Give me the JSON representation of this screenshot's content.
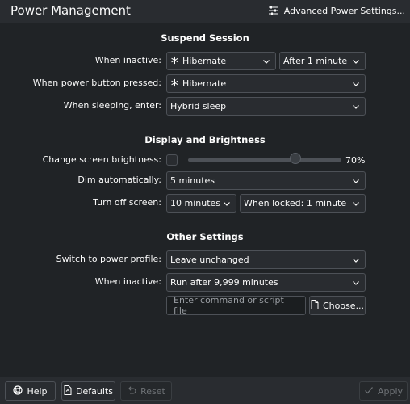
{
  "header": {
    "title": "Power Management",
    "advanced_label": "Advanced Power Settings..."
  },
  "suspend": {
    "title": "Suspend Session",
    "inactive_label": "When inactive:",
    "inactive_action": "Hibernate",
    "inactive_delay": "After 1 minute",
    "power_button_label": "When power button pressed:",
    "power_button_action": "Hibernate",
    "sleeping_label": "When sleeping, enter:",
    "sleeping_mode": "Hybrid sleep"
  },
  "display": {
    "title": "Display and Brightness",
    "brightness_label": "Change screen brightness:",
    "brightness_checked": false,
    "brightness_value": "70%",
    "brightness_fraction": 0.7,
    "dim_label": "Dim automatically:",
    "dim_value": "5 minutes",
    "turn_off_label": "Turn off screen:",
    "turn_off_value": "10 minutes",
    "turn_off_locked": "When locked: 1 minute"
  },
  "other": {
    "title": "Other Settings",
    "profile_label": "Switch to power profile:",
    "profile_value": "Leave unchanged",
    "inactive_label": "When inactive:",
    "inactive_value": "Run after 9,999 minutes",
    "command_placeholder": "Enter command or script file",
    "choose_label": "Choose..."
  },
  "footer": {
    "help_label": "Help",
    "defaults_label": "Defaults",
    "reset_label": "Reset",
    "apply_label": "Apply"
  },
  "icons": {
    "hibernate": "snowflake-icon",
    "advanced": "sliders-icon",
    "help": "lifebuoy-icon",
    "defaults": "document-revert-icon",
    "reset": "undo-icon",
    "apply": "checkmark-icon",
    "choose": "file-icon"
  },
  "colors": {
    "background": "#202326",
    "header": "#292c30",
    "border": "#4d5157",
    "text": "#fcfcfc",
    "disabled_text": "#6e7276"
  }
}
